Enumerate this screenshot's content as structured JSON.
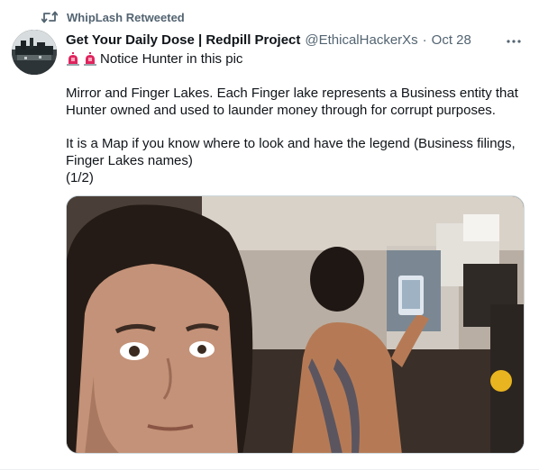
{
  "retweet": {
    "label": "WhipLash Retweeted",
    "icon": "retweet-icon"
  },
  "author": {
    "display_name": "Get Your Daily Dose | Redpill Project",
    "handle": "@EthicalHackerXs",
    "separator": "·",
    "date": "Oct 28"
  },
  "tweet": {
    "line1_emoji": "🚨🚨",
    "line1_text": "Notice Hunter in this pic",
    "paragraph2": "Mirror and Finger Lakes. Each Finger lake represents a Business entity that Hunter owned and used to launder money through for corrupt purposes.",
    "paragraph3": "It is a Map if you know where to look and have the legend (Business filings, Finger Lakes names)",
    "thread_marker": "(1/2)"
  },
  "icons": {
    "more": "more-options-icon",
    "siren": "police-siren-icon"
  },
  "colors": {
    "text_primary": "#0f1419",
    "text_secondary": "#536471",
    "border": "#cfd9de",
    "siren_red": "#e0245e"
  }
}
